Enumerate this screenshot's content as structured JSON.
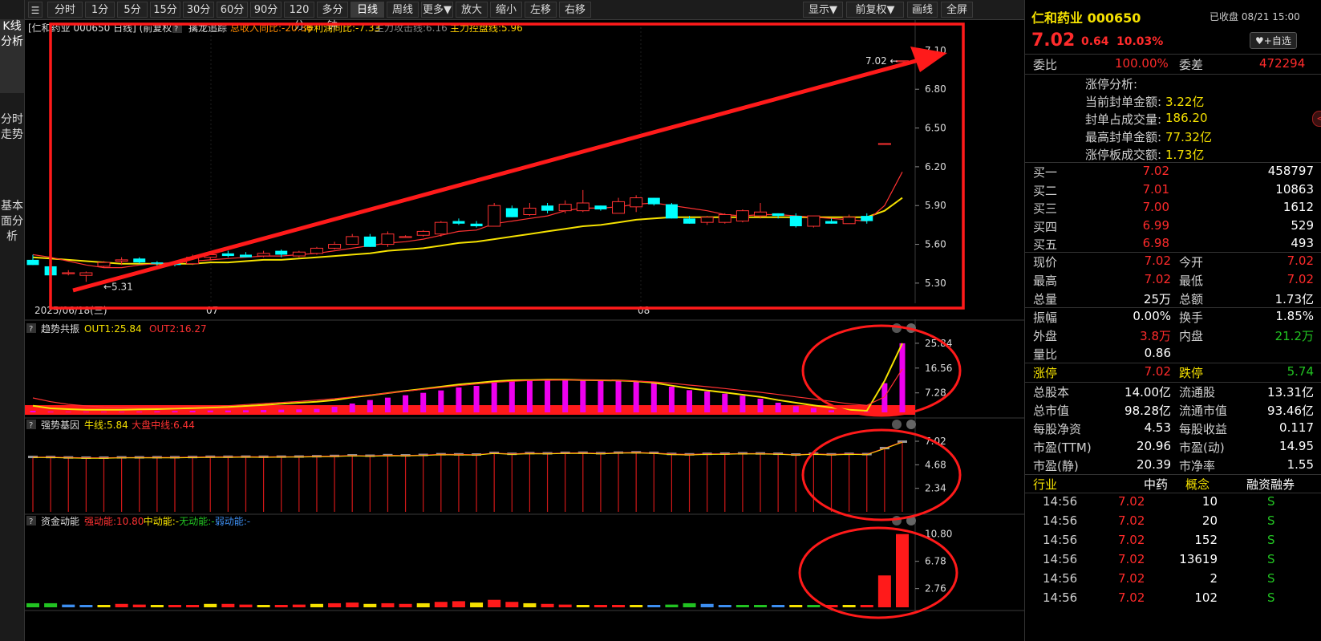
{
  "sidebar": [
    "K线分析",
    "分时走势",
    "基本面分析"
  ],
  "toolbar": [
    "分时",
    "1分",
    "5分",
    "15分",
    "30分",
    "60分",
    "90分",
    "120分",
    "多分钟",
    "日线",
    "周线",
    "更多▼",
    "放大",
    "缩小",
    "左移",
    "右移"
  ],
  "toolbar_right": [
    "显示▼",
    "前复权▼",
    "画线",
    "全屏"
  ],
  "main_header": {
    "title": "[仁和药业 000650 日线]",
    "adjust": "(前复权)",
    "help": "?",
    "indicator": "擒龙追踪",
    "items": [
      "总收入同比:-20.36",
      "净利润同比:-7.33",
      "主力攻击线:6.16",
      "主力控盘线:5.96"
    ]
  },
  "chart_data": [
    {
      "type": "candlestick",
      "title": "仁和药业 000650 日线",
      "ylim": [
        5.2,
        7.18
      ],
      "yticks": [
        "7.10",
        "6.80",
        "6.50",
        "6.20",
        "5.90",
        "5.60",
        "5.30"
      ],
      "xlabels": [
        "2025/06/18(三)",
        "07",
        "08"
      ],
      "ohlc": [
        [
          5.48,
          5.52,
          5.44,
          5.44
        ],
        [
          5.43,
          5.45,
          5.36,
          5.36
        ],
        [
          5.38,
          5.4,
          5.36,
          5.38
        ],
        [
          5.36,
          5.39,
          5.31,
          5.38
        ],
        [
          5.43,
          5.47,
          5.42,
          5.46
        ],
        [
          5.47,
          5.5,
          5.44,
          5.48
        ],
        [
          5.49,
          5.5,
          5.45,
          5.46
        ],
        [
          5.46,
          5.47,
          5.43,
          5.45
        ],
        [
          5.45,
          5.47,
          5.43,
          5.44
        ],
        [
          5.45,
          5.52,
          5.44,
          5.5
        ],
        [
          5.5,
          5.53,
          5.48,
          5.52
        ],
        [
          5.53,
          5.55,
          5.5,
          5.51
        ],
        [
          5.52,
          5.54,
          5.5,
          5.5
        ],
        [
          5.51,
          5.55,
          5.5,
          5.53
        ],
        [
          5.55,
          5.56,
          5.5,
          5.52
        ],
        [
          5.51,
          5.55,
          5.5,
          5.54
        ],
        [
          5.53,
          5.58,
          5.52,
          5.57
        ],
        [
          5.57,
          5.62,
          5.56,
          5.6
        ],
        [
          5.6,
          5.68,
          5.6,
          5.66
        ],
        [
          5.66,
          5.68,
          5.58,
          5.58
        ],
        [
          5.6,
          5.7,
          5.58,
          5.68
        ],
        [
          5.66,
          5.67,
          5.65,
          5.66
        ],
        [
          5.67,
          5.71,
          5.66,
          5.7
        ],
        [
          5.68,
          5.78,
          5.66,
          5.77
        ],
        [
          5.78,
          5.8,
          5.75,
          5.76
        ],
        [
          5.76,
          5.78,
          5.73,
          5.74
        ],
        [
          5.74,
          5.92,
          5.74,
          5.9
        ],
        [
          5.88,
          5.9,
          5.81,
          5.81
        ],
        [
          5.83,
          5.92,
          5.82,
          5.88
        ],
        [
          5.9,
          5.92,
          5.84,
          5.86
        ],
        [
          5.86,
          5.94,
          5.84,
          5.91
        ],
        [
          5.86,
          6.02,
          5.85,
          5.92
        ],
        [
          5.9,
          5.9,
          5.86,
          5.87
        ],
        [
          5.84,
          5.96,
          5.84,
          5.93
        ],
        [
          5.89,
          5.98,
          5.85,
          5.96
        ],
        [
          5.96,
          5.96,
          5.9,
          5.91
        ],
        [
          5.91,
          5.92,
          5.8,
          5.8
        ],
        [
          5.8,
          5.82,
          5.76,
          5.76
        ],
        [
          5.77,
          5.82,
          5.75,
          5.81
        ],
        [
          5.77,
          5.84,
          5.76,
          5.83
        ],
        [
          5.78,
          5.87,
          5.77,
          5.86
        ],
        [
          5.82,
          5.92,
          5.8,
          5.85
        ],
        [
          5.84,
          5.84,
          5.8,
          5.82
        ],
        [
          5.82,
          5.84,
          5.73,
          5.74
        ],
        [
          5.74,
          5.82,
          5.73,
          5.82
        ],
        [
          5.78,
          5.8,
          5.76,
          5.76
        ],
        [
          5.76,
          5.83,
          5.76,
          5.81
        ],
        [
          5.82,
          5.84,
          5.76,
          5.78
        ],
        [
          6.38,
          6.38,
          6.38,
          6.38
        ],
        [
          7.02,
          7.02,
          7.02,
          7.02
        ]
      ],
      "ma5": [
        5.52,
        5.5,
        5.47,
        5.44,
        5.42,
        5.42,
        5.44,
        5.45,
        5.46,
        5.47,
        5.48,
        5.49,
        5.5,
        5.51,
        5.51,
        5.52,
        5.53,
        5.55,
        5.57,
        5.59,
        5.61,
        5.62,
        5.64,
        5.67,
        5.7,
        5.71,
        5.76,
        5.78,
        5.8,
        5.82,
        5.86,
        5.88,
        5.88,
        5.89,
        5.91,
        5.92,
        5.9,
        5.88,
        5.86,
        5.83,
        5.82,
        5.83,
        5.83,
        5.82,
        5.81,
        5.8,
        5.79,
        5.78,
        5.9,
        6.16
      ],
      "ma10": [
        5.5,
        5.49,
        5.48,
        5.47,
        5.46,
        5.45,
        5.45,
        5.45,
        5.45,
        5.45,
        5.46,
        5.46,
        5.47,
        5.48,
        5.48,
        5.49,
        5.5,
        5.51,
        5.52,
        5.53,
        5.55,
        5.56,
        5.57,
        5.59,
        5.61,
        5.62,
        5.64,
        5.66,
        5.68,
        5.7,
        5.72,
        5.74,
        5.75,
        5.77,
        5.79,
        5.8,
        5.81,
        5.81,
        5.81,
        5.81,
        5.81,
        5.81,
        5.81,
        5.81,
        5.81,
        5.81,
        5.81,
        5.81,
        5.86,
        5.96
      ],
      "labels": {
        "high": "7.02",
        "low": "5.31"
      },
      "colors": {
        "up": "#ff3232",
        "down": "#00ffff",
        "ma5": "#ff3232",
        "ma10": "#f5e100"
      }
    },
    {
      "type": "bar",
      "title": "趋势共振",
      "series": [
        {
          "name": "OUT1",
          "value": 25.84
        },
        {
          "name": "OUT2",
          "value": 16.27
        }
      ],
      "yticks": [
        "25.84",
        "16.56",
        "7.28"
      ],
      "ylim": [
        0,
        27
      ],
      "bars": [
        0.6,
        0.3,
        0.2,
        0.2,
        0.2,
        0.2,
        0.3,
        0.4,
        0.5,
        0.6,
        0.7,
        0.7,
        0.8,
        0.9,
        1.0,
        1.1,
        1.3,
        2.1,
        3.3,
        4.6,
        5.5,
        6.4,
        7.3,
        8.2,
        9.3,
        9.9,
        11.4,
        12.1,
        12.0,
        11.9,
        12.2,
        12.0,
        11.8,
        11.9,
        11.6,
        11.1,
        9.6,
        8.3,
        7.8,
        7.0,
        6.2,
        5.1,
        3.6,
        2.3,
        1.6,
        0.8,
        0.3,
        0.2,
        10.9,
        25.84
      ],
      "out1": [
        2.5,
        1.5,
        1.2,
        1.0,
        1.0,
        1.0,
        1.1,
        1.2,
        1.4,
        1.6,
        1.8,
        2.0,
        2.4,
        2.8,
        3.2,
        3.6,
        4.0,
        4.6,
        5.6,
        6.4,
        7.2,
        8.0,
        8.8,
        9.6,
        10.4,
        11.0,
        11.6,
        12.0,
        12.1,
        12.2,
        12.2,
        12.1,
        12.0,
        11.9,
        11.6,
        11.1,
        10.0,
        9.0,
        8.2,
        7.4,
        6.6,
        5.8,
        4.6,
        3.6,
        2.6,
        1.8,
        1.0,
        0.6,
        11.8,
        25.84
      ],
      "out2": [
        5.4,
        4.0,
        3.0,
        2.4,
        2.0,
        1.8,
        1.7,
        1.7,
        1.8,
        2.0,
        2.2,
        2.5,
        2.9,
        3.3,
        3.7,
        4.1,
        4.6,
        5.1,
        5.8,
        6.5,
        7.2,
        7.9,
        8.6,
        9.3,
        10.0,
        10.6,
        11.2,
        11.6,
        11.9,
        12.0,
        12.1,
        12.1,
        12.0,
        11.9,
        11.7,
        11.4,
        10.9,
        10.2,
        9.6,
        8.9,
        8.2,
        7.5,
        6.7,
        5.8,
        5.0,
        4.1,
        3.2,
        2.6,
        5.8,
        16.27
      ]
    },
    {
      "type": "bar",
      "title": "强势基因",
      "series": [
        {
          "name": "牛线",
          "value": 5.84
        },
        {
          "name": "大盘中线",
          "value": 6.44
        }
      ],
      "yticks": [
        "7.02",
        "4.68",
        "2.34"
      ],
      "ylim": [
        0,
        7.5
      ],
      "bars": [
        5.5,
        5.49,
        5.45,
        5.43,
        5.43,
        5.46,
        5.46,
        5.47,
        5.47,
        5.49,
        5.52,
        5.52,
        5.53,
        5.52,
        5.53,
        5.54,
        5.57,
        5.6,
        5.66,
        5.62,
        5.68,
        5.66,
        5.7,
        5.77,
        5.76,
        5.74,
        5.9,
        5.81,
        5.88,
        5.86,
        5.91,
        5.92,
        5.87,
        5.93,
        5.96,
        5.91,
        5.8,
        5.76,
        5.81,
        5.83,
        5.86,
        5.85,
        5.82,
        5.74,
        5.82,
        5.76,
        5.81,
        5.78,
        6.38,
        7.02
      ]
    },
    {
      "type": "bar",
      "title": "资金动能",
      "series": [
        {
          "name": "强动能",
          "value": 10.8
        },
        {
          "name": "中动能",
          "value": "-"
        },
        {
          "name": "无动能",
          "value": "-"
        },
        {
          "name": "弱动能",
          "value": "-"
        }
      ],
      "yticks": [
        "10.80",
        "6.78",
        "2.76"
      ],
      "ylim": [
        0,
        11
      ],
      "values": [
        -0.6,
        -0.6,
        -0.4,
        -0.3,
        0.3,
        0.5,
        0.4,
        0.3,
        0.2,
        0.3,
        0.5,
        0.5,
        0.4,
        0.3,
        0.3,
        0.4,
        0.5,
        0.6,
        0.7,
        0.5,
        0.6,
        0.5,
        0.6,
        0.8,
        0.9,
        0.7,
        1.1,
        0.8,
        0.6,
        0.5,
        0.4,
        0.3,
        0.2,
        0.2,
        0.1,
        -0.2,
        -0.4,
        -0.6,
        -0.5,
        -0.3,
        -0.3,
        -0.2,
        -0.2,
        0.1,
        -0.2,
        0.2,
        0.2,
        0.2,
        4.7,
        10.8
      ],
      "colors": {
        "strong": "#ff1a1a",
        "mid": "#f5e100",
        "none": "#22c322",
        "weak": "#3d8ef0"
      }
    }
  ],
  "panel_headers": [
    {
      "title": "趋势共振",
      "items": [
        {
          "t": "OUT1:25.84",
          "c": "#f5e100"
        },
        {
          "t": "OUT2:16.27",
          "c": "#ff3232"
        }
      ]
    },
    {
      "title": "强势基因",
      "items": [
        {
          "t": "牛线:5.84",
          "c": "#f5e100"
        },
        {
          "t": "大盘中线:6.44",
          "c": "#ff3232"
        }
      ]
    },
    {
      "title": "资金动能",
      "items": [
        {
          "t": "强动能:10.80",
          "c": "#ff3232"
        },
        {
          "t": "中动能:-",
          "c": "#f5e100"
        },
        {
          "t": "无动能:-",
          "c": "#22c322"
        },
        {
          "t": "弱动能:-",
          "c": "#3d8ef0"
        }
      ]
    }
  ],
  "quote": {
    "name": "仁和药业 000650",
    "status": "已收盘 08/21 15:00",
    "price": "7.02",
    "change": "0.64",
    "pct": "10.03%",
    "fav": "♥+自选",
    "weibi_l": "委比",
    "weibi": "100.00%",
    "weicha_l": "委差",
    "weicha": "472294",
    "limit_title": "涨停分析:",
    "limit": [
      [
        "当前封单金额:",
        "3.22亿"
      ],
      [
        "封单占成交量:",
        "186.20"
      ],
      [
        "最高封单金额:",
        "77.32亿"
      ],
      [
        "涨停板成交额:",
        "1.73亿"
      ]
    ],
    "book": [
      [
        "买一",
        "7.02",
        "458797"
      ],
      [
        "买二",
        "7.01",
        "10863"
      ],
      [
        "买三",
        "7.00",
        "1612"
      ],
      [
        "买四",
        "6.99",
        "529"
      ],
      [
        "买五",
        "6.98",
        "493"
      ]
    ],
    "stats": [
      [
        "现价",
        "7.02",
        "今开",
        "7.02"
      ],
      [
        "最高",
        "7.02",
        "最低",
        "7.02"
      ],
      [
        "总量",
        "25万",
        "总额",
        "1.73亿"
      ]
    ],
    "stats2": [
      [
        "振幅",
        "0.00%",
        "换手",
        "1.85%"
      ],
      [
        "外盘",
        "3.8万",
        "内盘",
        "21.2万"
      ],
      [
        "量比",
        "0.86",
        "",
        ""
      ]
    ],
    "stats3": [
      [
        "涨停",
        "7.02",
        "跌停",
        "5.74"
      ]
    ],
    "fund": [
      [
        "总股本",
        "14.00亿",
        "流通股",
        "13.31亿"
      ],
      [
        "总市值",
        "98.28亿",
        "流通市值",
        "93.46亿"
      ],
      [
        "每股净资",
        "4.53",
        "每股收益",
        "0.117"
      ],
      [
        "市盈(TTM)",
        "20.96",
        "市盈(动)",
        "14.95"
      ],
      [
        "市盈(静)",
        "20.39",
        "市净率",
        "1.55"
      ]
    ],
    "industry": [
      "行业",
      "中药",
      "概念",
      "融资融券"
    ],
    "trades": [
      [
        "14:56",
        "7.02",
        "10",
        "S"
      ],
      [
        "14:56",
        "7.02",
        "20",
        "S"
      ],
      [
        "14:56",
        "7.02",
        "152",
        "S"
      ],
      [
        "14:56",
        "7.02",
        "13619",
        "S"
      ],
      [
        "14:56",
        "7.02",
        "2",
        "S"
      ],
      [
        "14:56",
        "7.02",
        "102",
        "S"
      ]
    ]
  }
}
